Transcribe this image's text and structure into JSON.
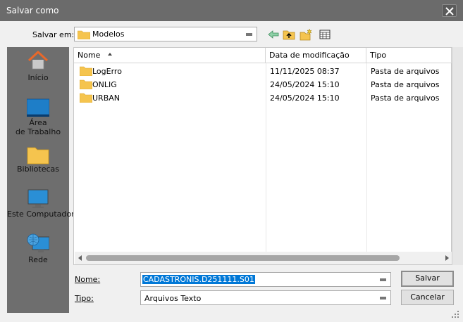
{
  "window": {
    "title": "Salvar como"
  },
  "toolbar": {
    "save_in_label": "Salvar em:",
    "current_folder": "Modelos"
  },
  "places": [
    {
      "label": "Início",
      "icon": "home-icon"
    },
    {
      "label": "Área\nde Trabalho",
      "icon": "desktop-icon"
    },
    {
      "label": "Bibliotecas",
      "icon": "libraries-icon"
    },
    {
      "label": "Este Computador",
      "icon": "computer-icon"
    },
    {
      "label": "Rede",
      "icon": "network-icon"
    }
  ],
  "columns": {
    "name": "Nome",
    "date": "Data de modificação",
    "type": "Tipo"
  },
  "files": [
    {
      "name": "LogErro",
      "date": "11/11/2025 08:37",
      "type": "Pasta de arquivos"
    },
    {
      "name": "ONLIG",
      "date": "24/05/2024 15:10",
      "type": "Pasta de arquivos"
    },
    {
      "name": "URBAN",
      "date": "24/05/2024 15:10",
      "type": "Pasta de arquivos"
    }
  ],
  "form": {
    "name_label": "Nome:",
    "name_value": "CADASTRONIS.D251111.S01",
    "type_label": "Tipo:",
    "type_value": "Arquivos Texto"
  },
  "buttons": {
    "save": "Salvar",
    "cancel": "Cancelar"
  },
  "colors": {
    "titlebar": "#6b6b6b",
    "selection": "#0078d7",
    "folder": "#f5c44e",
    "places_bg": "#6e6e6e"
  }
}
